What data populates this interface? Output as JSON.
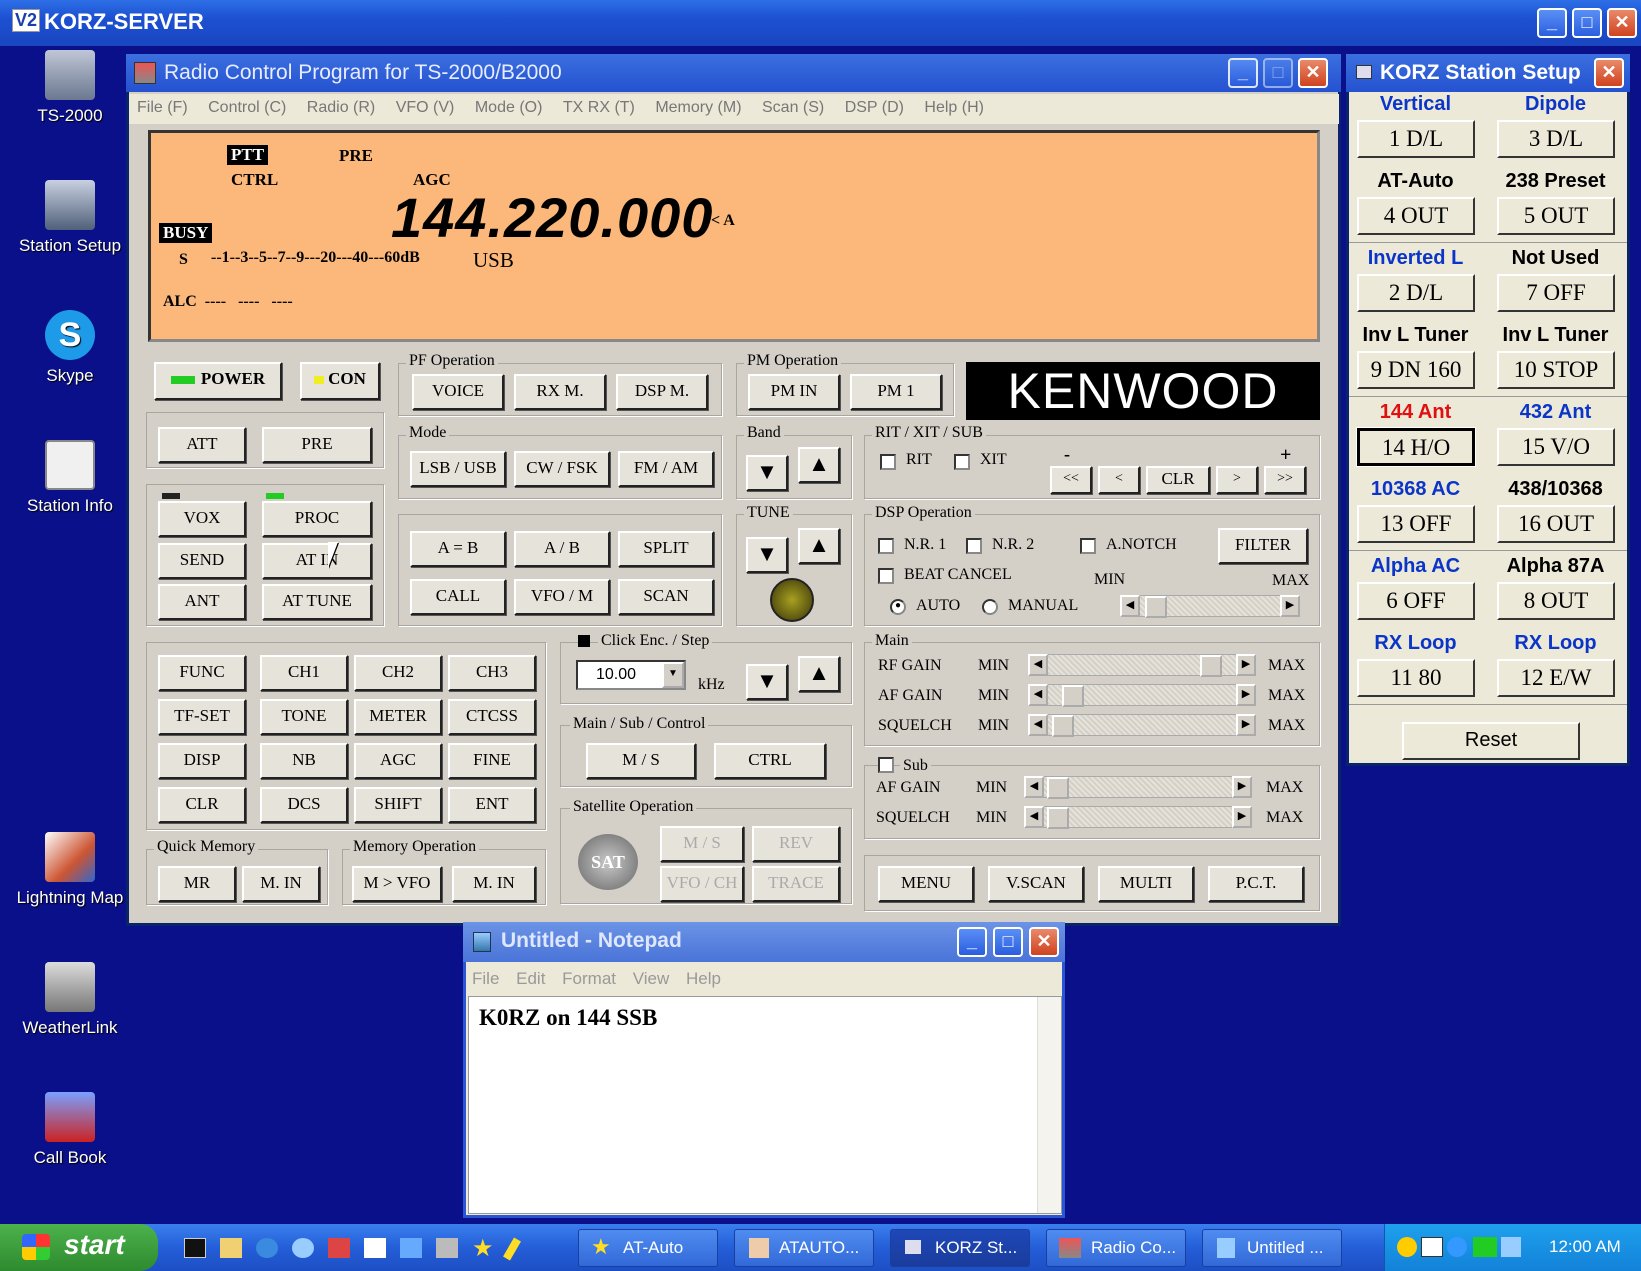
{
  "screen": {
    "title": "KORZ-SERVER",
    "logo": "V2"
  },
  "desktop": {
    "icons": [
      {
        "name": "desktop-icon-ts2000",
        "label": "TS-2000"
      },
      {
        "name": "desktop-icon-station-setup",
        "label": "Station Setup"
      },
      {
        "name": "desktop-icon-skype",
        "label": "Skype"
      },
      {
        "name": "desktop-icon-station-info",
        "label": "Station  Info"
      },
      {
        "name": "desktop-icon-lightning-map",
        "label": "Lightning Map"
      },
      {
        "name": "desktop-icon-weatherlink",
        "label": "WeatherLink"
      },
      {
        "name": "desktop-icon-call-book",
        "label": "Call Book"
      }
    ]
  },
  "rcp": {
    "title": "Radio Control Program for TS-2000/B2000",
    "menu": [
      "File (F)",
      "Control (C)",
      "Radio (R)",
      "VFO (V)",
      "Mode (O)",
      "TX RX (T)",
      "Memory (M)",
      "Scan (S)",
      "DSP (D)",
      "Help (H)"
    ],
    "display": {
      "ptt": "PTT",
      "pre": "PRE",
      "ctrl": "CTRL",
      "agc": "AGC",
      "busy": "BUSY",
      "frequency": "144.220.000",
      "vfo": "< A",
      "s_label": "S",
      "s_scale": "--1--3--5--7--9---20---40---60dB",
      "mode": "USB",
      "alc": "ALC  ----   ----   ----"
    },
    "power": "POWER",
    "con": "CON",
    "att": "ATT",
    "pre": "PRE",
    "vox": "VOX",
    "proc": "PROC",
    "send": "SEND",
    "at_in": "AT IN",
    "ant": "ANT",
    "at_tune": "AT TUNE",
    "pf_operation": {
      "label": "PF Operation",
      "voice": "VOICE",
      "rxm": "RX M.",
      "dspm": "DSP M."
    },
    "pm_operation": {
      "label": "PM Operation",
      "pm_in": "PM IN",
      "pm1": "PM 1"
    },
    "kenwood": "KENWOOD",
    "mode": {
      "label": "Mode",
      "lsb_usb": "LSB / USB",
      "cw_fsk": "CW / FSK",
      "fm_am": "FM / AM"
    },
    "band": {
      "label": "Band",
      "down": "▼",
      "up": "▲"
    },
    "vfo_group": {
      "a_eq_b": "A = B",
      "a_b": "A / B",
      "split": "SPLIT",
      "call": "CALL",
      "vfo_m": "VFO / M",
      "scan": "SCAN"
    },
    "tune": {
      "label": "TUNE",
      "down": "▼",
      "up": "▲"
    },
    "rit": {
      "label": "RIT / XIT / SUB",
      "rit": "RIT",
      "xit": "XIT",
      "minus": "-",
      "plus": "+",
      "ll": "<<",
      "l": "<",
      "clr": "CLR",
      "r": ">",
      "rr": ">>"
    },
    "dsp": {
      "label": "DSP Operation",
      "nr1": "N.R. 1",
      "nr2": "N.R. 2",
      "anotch": "A.NOTCH",
      "filter": "FILTER",
      "beat": "BEAT CANCEL",
      "min": "MIN",
      "max": "MAX",
      "auto": "AUTO",
      "manual": "MANUAL"
    },
    "func_grid": [
      "FUNC",
      "CH1",
      "CH2",
      "CH3",
      "TF-SET",
      "TONE",
      "METER",
      "CTCSS",
      "DISP",
      "NB",
      "AGC",
      "FINE",
      "CLR",
      "DCS",
      "SHIFT",
      "ENT"
    ],
    "click_enc": {
      "label": "Click Enc. / Step",
      "value": "10.00",
      "unit": "kHz",
      "down": "▼",
      "up": "▲"
    },
    "msc": {
      "label": "Main / Sub / Control",
      "ms": "M / S",
      "ctrl": "CTRL"
    },
    "sat": {
      "label": "Satellite Operation",
      "icon": "SAT",
      "ms": "M / S",
      "rev": "REV",
      "vfo_ch": "VFO / CH",
      "trace": "TRACE"
    },
    "main": {
      "label": "Main",
      "rf": "RF GAIN",
      "af": "AF GAIN",
      "sq": "SQUELCH",
      "min": "MIN",
      "max": "MAX",
      "rf_level": 0.93,
      "af_level": 0.08,
      "sq_level": 0.02
    },
    "sub": {
      "label": "Sub",
      "af": "AF GAIN",
      "sq": "SQUELCH",
      "min": "MIN",
      "max": "MAX"
    },
    "quick": {
      "label": "Quick Memory",
      "mr": "MR",
      "min": "M. IN"
    },
    "memop": {
      "label": "Memory Operation",
      "mvfo": "M > VFO",
      "min": "M. IN"
    },
    "bottom": [
      "MENU",
      "V.SCAN",
      "MULTI",
      "P.C.T."
    ]
  },
  "station": {
    "title": "KORZ Station Setup",
    "cells": [
      {
        "head": "Vertical",
        "btn": "1  D/L",
        "color": "#0b35c8"
      },
      {
        "head": "Dipole",
        "btn": "3  D/L",
        "color": "#0b35c8"
      },
      {
        "head": "AT-Auto",
        "btn": "4  OUT",
        "color": "#000000"
      },
      {
        "head": "238 Preset",
        "btn": "5  OUT",
        "color": "#000000"
      },
      {
        "head": "Inverted L",
        "btn": "2  D/L",
        "color": "#0b35c8"
      },
      {
        "head": "Not Used",
        "btn": "7  OFF",
        "color": "#000000"
      },
      {
        "head": "Inv L Tuner",
        "btn": "9 DN 160",
        "color": "#000000"
      },
      {
        "head": "Inv L Tuner",
        "btn": "10 STOP",
        "color": "#000000"
      },
      {
        "head": "144  Ant",
        "btn": "14  H/O",
        "color": "#e01010"
      },
      {
        "head": "432  Ant",
        "btn": "15  V/O",
        "color": "#0b35c8"
      },
      {
        "head": "10368  AC",
        "btn": "13  OFF",
        "color": "#0b35c8"
      },
      {
        "head": "438/10368",
        "btn": "16  OUT",
        "color": "#000000"
      },
      {
        "head": "Alpha  AC",
        "btn": "6  OFF",
        "color": "#0b35c8"
      },
      {
        "head": "Alpha 87A",
        "btn": "8  OUT",
        "color": "#000000"
      },
      {
        "head": "RX Loop",
        "btn": "11  80",
        "color": "#0b35c8"
      },
      {
        "head": "RX Loop",
        "btn": "12  E/W",
        "color": "#0b35c8"
      }
    ],
    "reset": "Reset"
  },
  "notepad": {
    "title": "Untitled - Notepad",
    "menu": [
      "File",
      "Edit",
      "Format",
      "View",
      "Help"
    ],
    "text": "K0RZ on 144 SSB"
  },
  "taskbar": {
    "start": "start",
    "tasks": [
      "AT-Auto",
      "ATAUTO...",
      "KORZ St...",
      "Radio Co...",
      "Untitled ..."
    ],
    "clock": "12:00 AM"
  }
}
